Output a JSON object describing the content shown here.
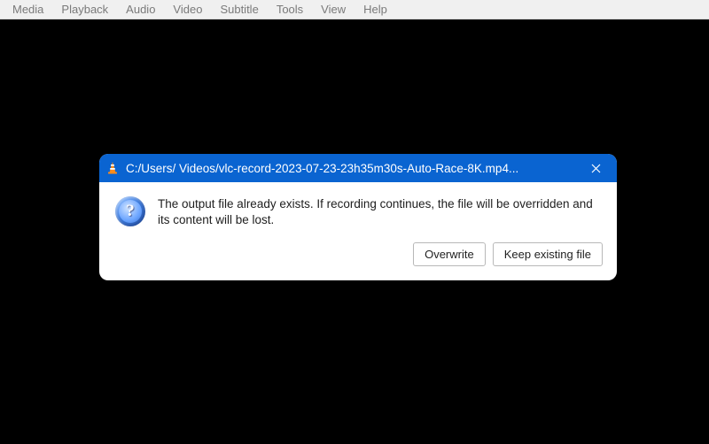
{
  "menubar": {
    "items": [
      "Media",
      "Playback",
      "Audio",
      "Video",
      "Subtitle",
      "Tools",
      "View",
      "Help"
    ]
  },
  "dialog": {
    "icon": "vlc-cone-icon",
    "title": "C:/Users/  Videos/vlc-record-2023-07-23-23h35m30s-Auto-Race-8K.mp4...",
    "close_glyph": "✕",
    "question_glyph": "?",
    "message": "The output file already exists. If recording continues, the file will be overridden and its content will be lost.",
    "buttons": {
      "overwrite": "Overwrite",
      "keep": "Keep existing file"
    }
  }
}
